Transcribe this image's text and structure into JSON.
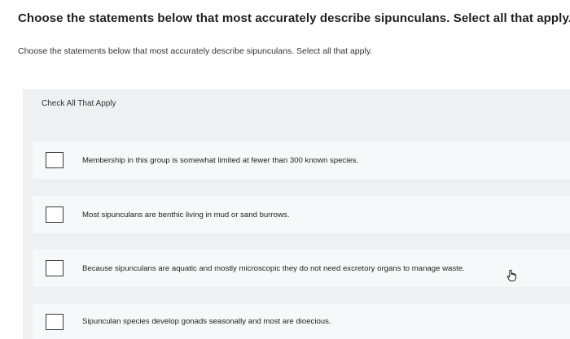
{
  "question": {
    "title": "Choose the statements below that most accurately describe sipunculans. Select all that apply.",
    "prompt": "Choose the statements below that most accurately describe sipunculans. Select all that apply."
  },
  "check_panel": {
    "heading": "Check All That Apply",
    "options": [
      {
        "label": "Membership in this group is somewhat limited at fewer than 300 known species.",
        "checked": false
      },
      {
        "label": "Most sipunculans are benthic living in mud or sand burrows.",
        "checked": false
      },
      {
        "label": "Because sipunculans are aquatic and mostly microscopic they do not need excretory organs to manage waste.",
        "checked": false
      },
      {
        "label": "Sipunculan species develop gonads seasonally and most are dioecious.",
        "checked": false
      }
    ]
  },
  "icons": {
    "cursor": "hand-pointer-icon"
  },
  "colors": {
    "panel_background": "#eef0f2",
    "row_background": "#f7f8f9",
    "checkbox_border": "#3a3a3a"
  }
}
